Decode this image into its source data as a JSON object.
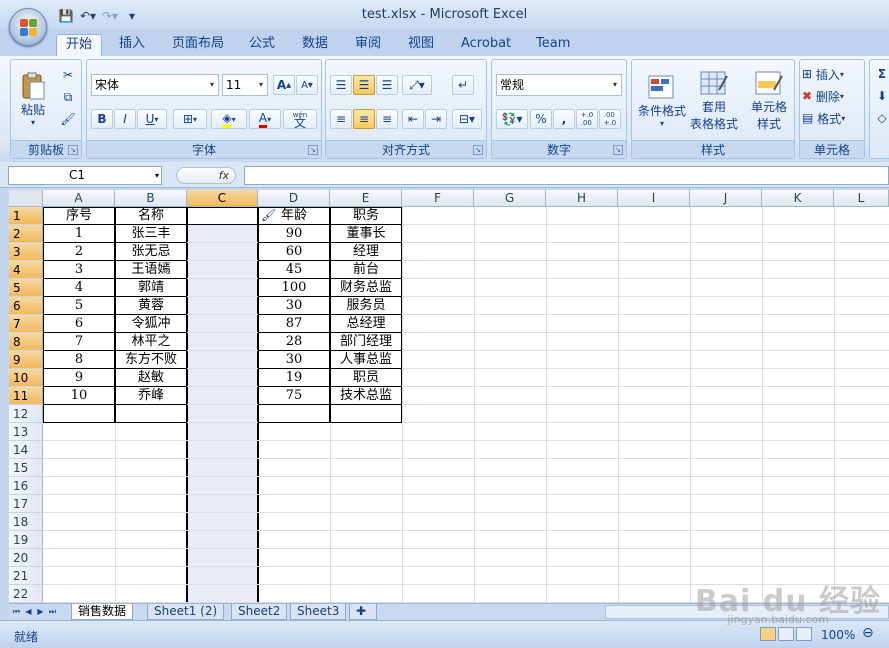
{
  "window": {
    "title": "test.xlsx - Microsoft Excel"
  },
  "tabs": [
    "开始",
    "插入",
    "页面布局",
    "公式",
    "数据",
    "审阅",
    "视图",
    "Acrobat",
    "Team"
  ],
  "ribbon": {
    "clipboard": {
      "paste": "粘贴",
      "label": "剪贴板"
    },
    "font": {
      "name": "宋体",
      "size": "11",
      "bold": "B",
      "italic": "I",
      "underline": "U",
      "grow": "A",
      "shrink": "A",
      "color_a": "A",
      "wen": "wén",
      "wen_char": "文",
      "label": "字体"
    },
    "align": {
      "label": "对齐方式"
    },
    "number": {
      "format": "常规",
      "percent": "%",
      "comma": ",",
      "inc": "+.0\n.00",
      "dec": ".00\n+.0",
      "label": "数字"
    },
    "styles": {
      "cond": "条件格式",
      "table1": "套用",
      "table2": "表格格式",
      "cell1": "单元格",
      "cell2": "样式",
      "label": "样式"
    },
    "cells": {
      "insert": "插入",
      "delete": "删除",
      "format": "格式",
      "label": "单元格"
    }
  },
  "formula_bar": {
    "name_box": "C1",
    "fx": "fx",
    "value": ""
  },
  "columns": [
    "A",
    "B",
    "C",
    "D",
    "E",
    "F",
    "G",
    "H",
    "I",
    "J",
    "K",
    "L"
  ],
  "rows": [
    "1",
    "2",
    "3",
    "4",
    "5",
    "6",
    "7",
    "8",
    "9",
    "10",
    "11",
    "12",
    "13",
    "14",
    "15",
    "16",
    "17",
    "18",
    "19",
    "20",
    "21",
    "22"
  ],
  "table": {
    "headers": [
      "序号",
      "名称",
      "",
      "年龄",
      "职务"
    ],
    "data": [
      [
        "1",
        "张三丰",
        "",
        "90",
        "董事长"
      ],
      [
        "2",
        "张无忌",
        "",
        "60",
        "经理"
      ],
      [
        "3",
        "王语嫣",
        "",
        "45",
        "前台"
      ],
      [
        "4",
        "郭靖",
        "",
        "100",
        "财务总监"
      ],
      [
        "5",
        "黄蓉",
        "",
        "30",
        "服务员"
      ],
      [
        "6",
        "令狐冲",
        "",
        "87",
        "总经理"
      ],
      [
        "7",
        "林平之",
        "",
        "28",
        "部门经理"
      ],
      [
        "8",
        "东方不败",
        "",
        "30",
        "人事总监"
      ],
      [
        "9",
        "赵敏",
        "",
        "19",
        "职员"
      ],
      [
        "10",
        "乔峰",
        "",
        "75",
        "技术总监"
      ]
    ]
  },
  "sheets": [
    "销售数据",
    "Sheet1 (2)",
    "Sheet2",
    "Sheet3"
  ],
  "status": {
    "ready": "就绪",
    "zoom": "100%"
  },
  "watermark": {
    "logo": "Bai du 经验",
    "url": "jingyan.baidu.com"
  }
}
